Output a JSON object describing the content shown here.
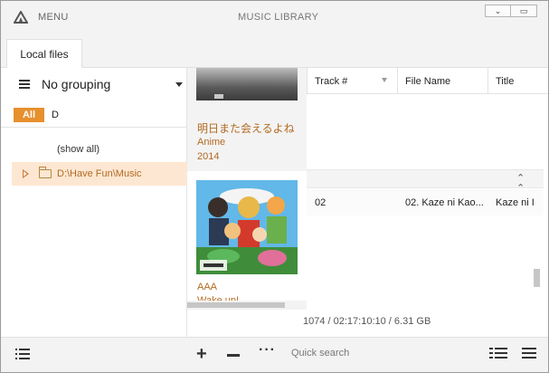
{
  "titlebar": {
    "menu_label": "MENU",
    "app_title": "MUSIC LIBRARY",
    "buttons": {
      "minimize": "⌄",
      "restore": "▭"
    }
  },
  "tabs": [
    {
      "label": "Local files",
      "active": true
    }
  ],
  "sidebar": {
    "grouping_label": "No grouping",
    "filter_all": "All",
    "filter_letter": "D",
    "show_all": "(show all)",
    "folders": [
      {
        "label": "D:\\Have Fun\\Music",
        "selected": true
      }
    ]
  },
  "albums": [
    {
      "title": "明日また会えるよね",
      "artist": "Anime",
      "year": "2014"
    },
    {
      "artist": "AAA",
      "title": "Wake up!"
    }
  ],
  "tracklist": {
    "columns": [
      "Track #",
      "File Name",
      "Title"
    ],
    "rows": [
      {
        "track": "02",
        "file_name": "02. Kaze ni Kao...",
        "title": "Kaze ni I"
      }
    ]
  },
  "summary": "1074 / 02:17:10:10 / 6.31 GB",
  "bottombar": {
    "quick_search": "Quick search",
    "plus": "+",
    "dots": "···"
  },
  "colors": {
    "accent": "#e6902e",
    "accent_text": "#b36a22",
    "selection_bg": "#fde7d2",
    "chrome_bg": "#f3f3f3"
  },
  "icons": [
    "app-logo-icon",
    "hamburger-icon",
    "caret-down-icon",
    "expand-arrow-icon",
    "folder-icon",
    "filter-icon",
    "collapse-up-icon",
    "list-icon",
    "add-icon",
    "remove-icon",
    "more-icon",
    "detail-view-icon",
    "menu-icon"
  ]
}
